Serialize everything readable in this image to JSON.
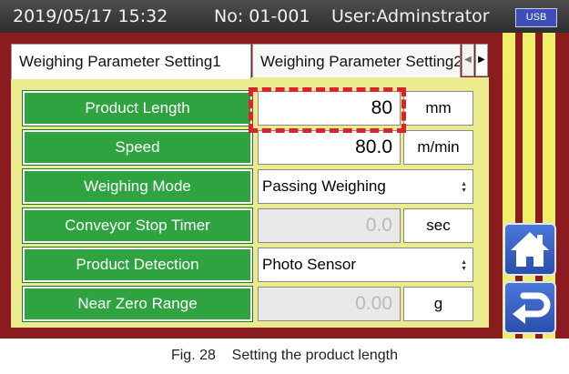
{
  "status_bar": {
    "datetime": "2019/05/17 15:32",
    "number": "No: 01-001",
    "user": "User:Adminstrator",
    "usb_label": "USB"
  },
  "tabs": [
    {
      "label": "Weighing Parameter Setting1",
      "active": true
    },
    {
      "label": "Weighing Parameter Setting2",
      "active": false
    }
  ],
  "rows": [
    {
      "label": "Product Length",
      "value": "80",
      "unit": "mm",
      "editable": true
    },
    {
      "label": "Speed",
      "value": "80.0",
      "unit": "m/min",
      "editable": true
    },
    {
      "label": "Weighing Mode",
      "value": "Passing Weighing",
      "type": "select"
    },
    {
      "label": "Conveyor Stop Timer",
      "value": "0.0",
      "unit": "sec",
      "editable": false
    },
    {
      "label": "Product Detection",
      "value": "Photo Sensor",
      "type": "select"
    },
    {
      "label": "Near Zero Range",
      "value": "0.00",
      "unit": "g",
      "editable": false
    }
  ],
  "buttons": {
    "home_icon": "home-icon",
    "back_icon": "return-arrow-icon"
  },
  "colors": {
    "frame": "#8a1c1f",
    "label_green": "#2ea33f",
    "panel_yellow": "#ecea8f",
    "highlight_red": "#d9232f",
    "nav_blue": "#2a4fae"
  },
  "caption": "Fig. 28    Setting the product length"
}
